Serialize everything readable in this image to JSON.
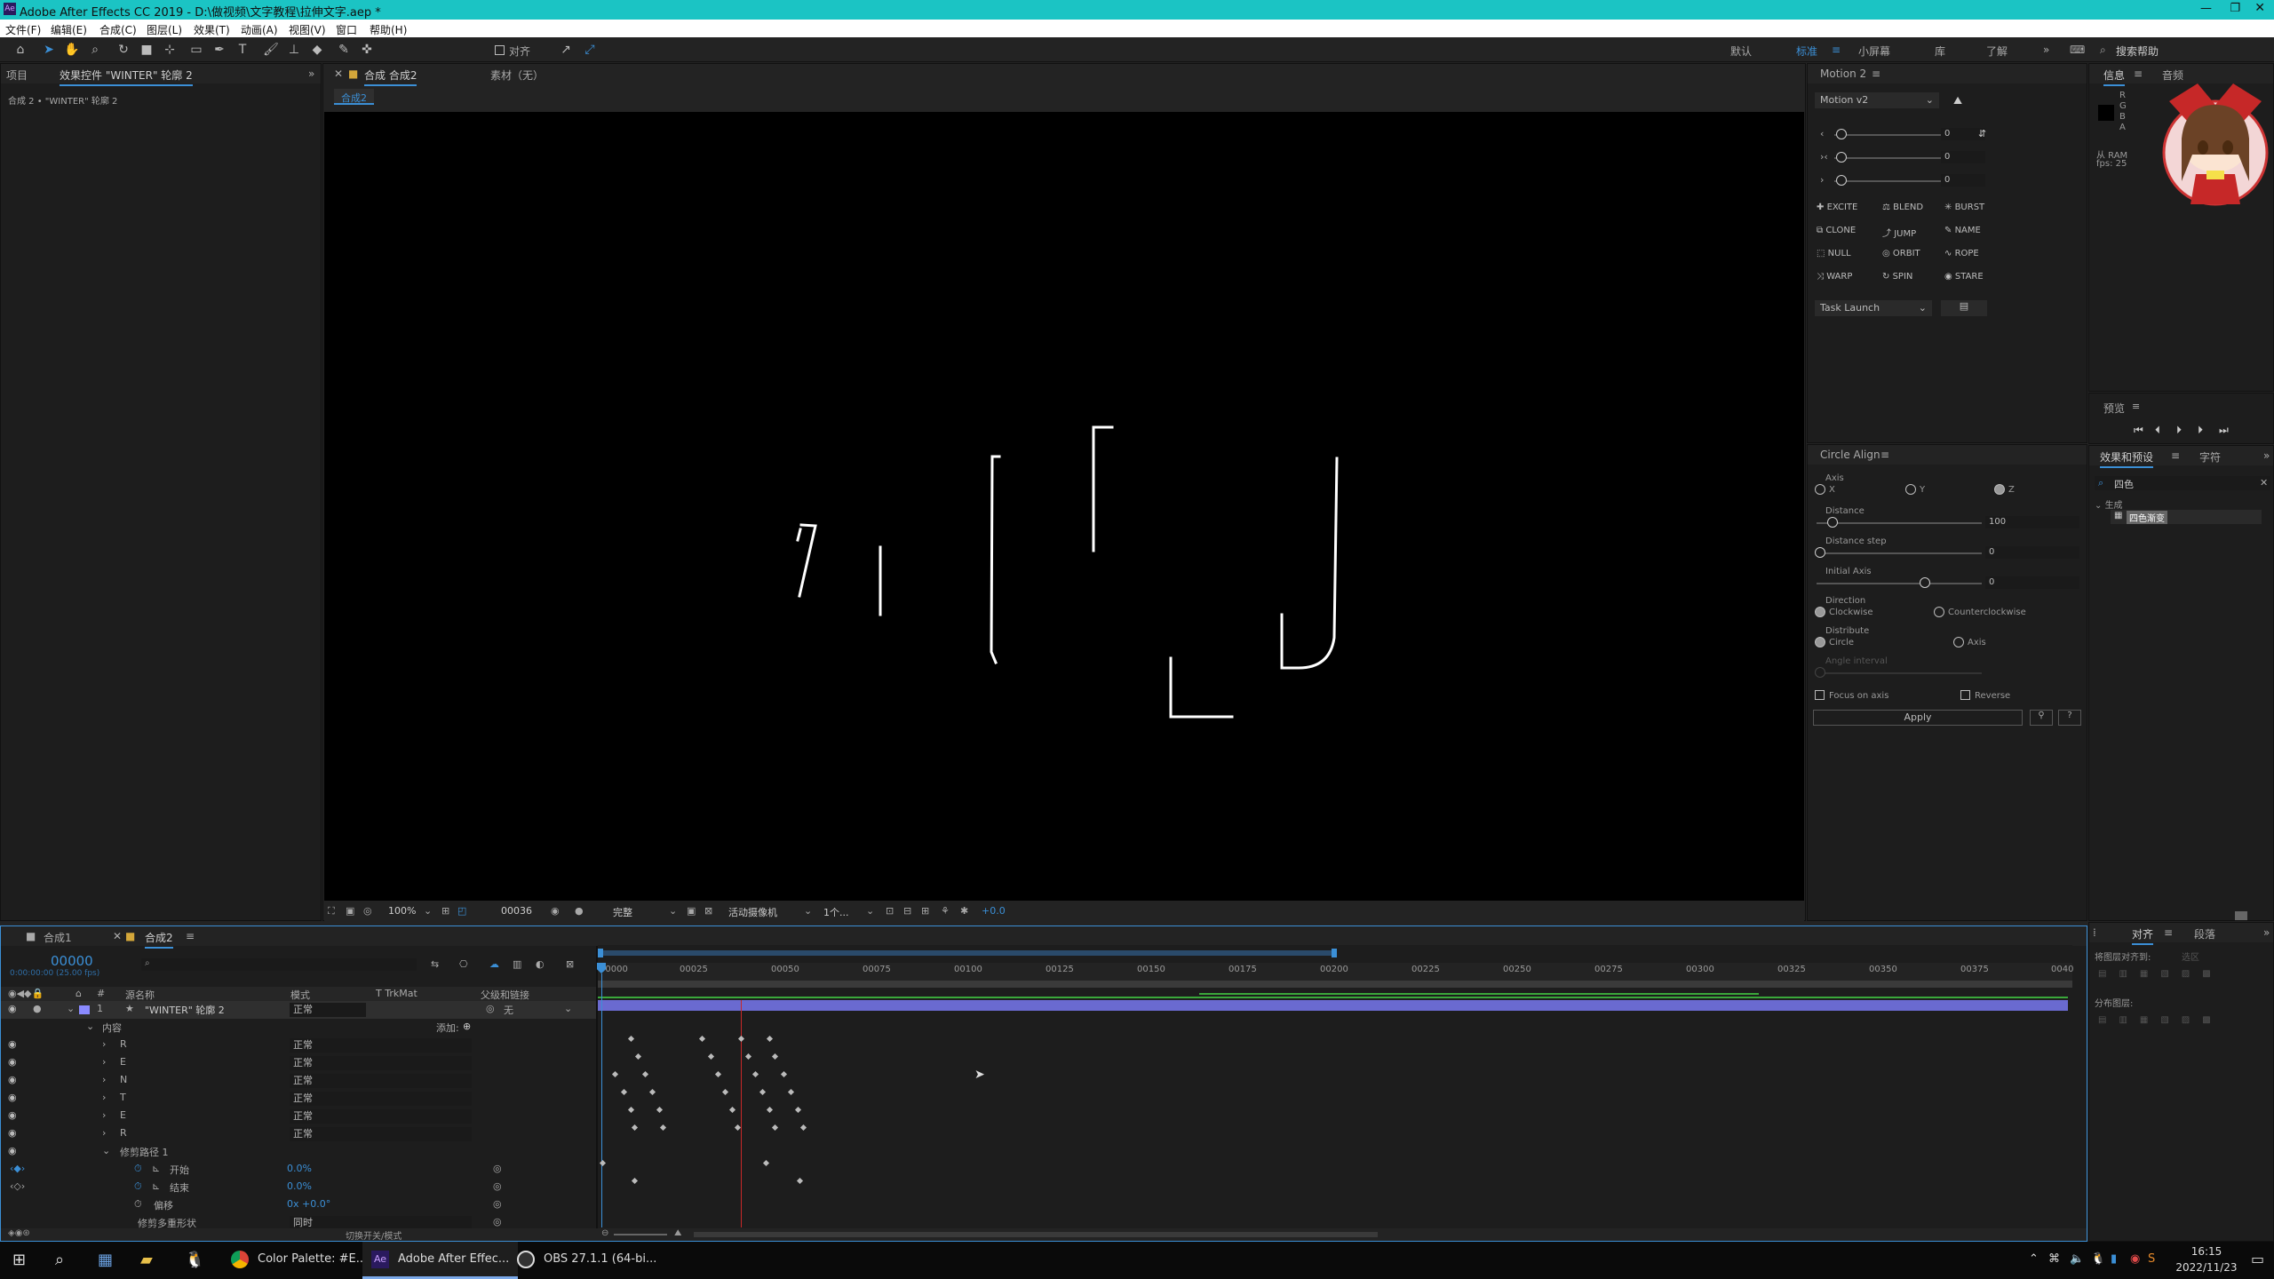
{
  "window": {
    "title": "Adobe After Effects CC 2019 - D:\\做视频\\文字教程\\拉伸文字.aep *",
    "app_icon": "Ae"
  },
  "menu": [
    "文件(F)",
    "编辑(E)",
    "合成(C)",
    "图层(L)",
    "效果(T)",
    "动画(A)",
    "视图(V)",
    "窗口",
    "帮助(H)"
  ],
  "toolbar": {
    "align_label": "对齐",
    "workspaces": [
      "默认",
      "标准",
      "小屏幕",
      "库",
      "了解"
    ],
    "search_placeholder": "搜索帮助"
  },
  "project_panel": {
    "tab1": "项目",
    "tab2": "效果控件 \"WINTER\" 轮廓 2",
    "breadcrumb": "合成 2 • \"WINTER\" 轮廓 2"
  },
  "comp_panel": {
    "tab": "合成 合成2",
    "footage_tab": "素材（无）",
    "comp_chip": "合成2"
  },
  "viewer_bar": {
    "zoom": "100%",
    "time": "00036",
    "quality": "完整",
    "camera": "活动摄像机",
    "views": "1个...",
    "exposure": "+0.0"
  },
  "motion": {
    "title": "Motion 2",
    "preset": "Motion v2",
    "slider_values": [
      "0",
      "0",
      "0"
    ],
    "buttons": [
      "EXCITE",
      "BLEND",
      "BURST",
      "CLONE",
      "JUMP",
      "NAME",
      "NULL",
      "ORBIT",
      "ROPE",
      "WARP",
      "SPIN",
      "STARE"
    ],
    "task": "Task Launch"
  },
  "circle_align": {
    "title": "Circle Align",
    "axis_label": "Axis",
    "axis_opts": [
      "X",
      "Y",
      "Z"
    ],
    "distance_label": "Distance",
    "distance": "100",
    "step_label": "Distance step",
    "step": "0",
    "initial_label": "Initial Axis",
    "initial": "0",
    "direction_label": "Direction",
    "dir_opts": [
      "Clockwise",
      "Counterclockwise"
    ],
    "distribute_label": "Distribute",
    "dist_opts": [
      "Circle",
      "Axis"
    ],
    "angle_label": "Angle interval",
    "focus": "Focus on axis",
    "reverse": "Reverse",
    "apply": "Apply"
  },
  "info_panel": {
    "tab1": "信息",
    "tab2": "音频",
    "lines": [
      "R",
      "G",
      "B",
      "A"
    ],
    "ram": "从 RAM",
    "fps": "fps: 25"
  },
  "preview_panel": {
    "title": "预览"
  },
  "effects_panel": {
    "tab1": "效果和预设",
    "tab2": "字符",
    "search": "四色",
    "category": "生成",
    "item": "四色渐变"
  },
  "align_panel": {
    "tab1": "对齐",
    "tab2": "段落",
    "align_to": "将图层对齐到:",
    "align_target": "选区",
    "distribute": "分布图层:"
  },
  "timeline": {
    "tabs": [
      "合成1",
      "合成2"
    ],
    "timecode": "00000",
    "timecode_sub": "0:00:00:00 (25.00 fps)",
    "columns": {
      "name": "源名称",
      "mode": "模式",
      "trkmat": "T  TrkMat",
      "parent": "父级和链接"
    },
    "layer": {
      "num": "1",
      "name": "\"WINTER\" 轮廓 2",
      "mode": "正常",
      "parent": "无"
    },
    "contents": "内容",
    "add": "添加:",
    "groups": [
      {
        "name": "R",
        "mode": "正常"
      },
      {
        "name": "E",
        "mode": "正常"
      },
      {
        "name": "N",
        "mode": "正常"
      },
      {
        "name": "T",
        "mode": "正常"
      },
      {
        "name": "E",
        "mode": "正常"
      },
      {
        "name": "R",
        "mode": "正常"
      }
    ],
    "trim": "修剪路径 1",
    "start_label": "开始",
    "start_val": "0.0%",
    "end_label": "结束",
    "end_val": "0.0%",
    "offset_label": "偏移",
    "offset_val": "0x +0.0°",
    "trim_multi": "修剪多重形状",
    "trim_mode": "同时",
    "switch_label": "切换开关/模式",
    "ruler": [
      "00000",
      "00025",
      "00050",
      "00075",
      "00100",
      "00125",
      "00150",
      "00175",
      "00200",
      "00225",
      "00250",
      "00275",
      "00300",
      "00325",
      "00350",
      "00375",
      "0040"
    ]
  },
  "taskbar": {
    "apps": [
      "Color Palette: #E...",
      "Adobe After Effec...",
      "OBS 27.1.1 (64-bi..."
    ],
    "time": "16:15",
    "date": "2022/11/23"
  },
  "colors": {
    "titlebar": "#1bc4c4",
    "accent": "#3b8fd6",
    "playhead": "#c82828",
    "workbar": "#6a6ad0"
  }
}
